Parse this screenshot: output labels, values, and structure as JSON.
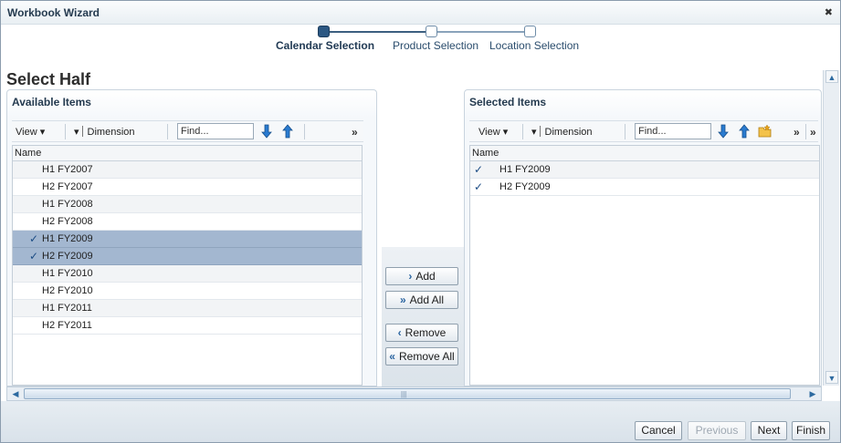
{
  "window": {
    "title": "Workbook Wizard",
    "close_glyph": "✖"
  },
  "train": {
    "steps": [
      {
        "label": "Calendar Selection",
        "active": true
      },
      {
        "label": "Product Selection",
        "active": false
      },
      {
        "label": "Location Selection",
        "active": false
      }
    ]
  },
  "page_title": "Select Half",
  "available": {
    "header": "Available Items",
    "toolbar": {
      "view_label": "View",
      "dimension_label": "Dimension",
      "find_placeholder": "Find...",
      "more_glyph": "»"
    },
    "column": "Name",
    "rows": [
      {
        "label": "H1 FY2007",
        "selected": false
      },
      {
        "label": "H2 FY2007",
        "selected": false
      },
      {
        "label": "H1 FY2008",
        "selected": false
      },
      {
        "label": "H2 FY2008",
        "selected": false
      },
      {
        "label": "H1 FY2009",
        "selected": true
      },
      {
        "label": "H2 FY2009",
        "selected": true
      },
      {
        "label": "H1 FY2010",
        "selected": false
      },
      {
        "label": "H2 FY2010",
        "selected": false
      },
      {
        "label": "H1 FY2011",
        "selected": false
      },
      {
        "label": "H2 FY2011",
        "selected": false
      }
    ]
  },
  "selected": {
    "header": "Selected Items",
    "toolbar": {
      "view_label": "View",
      "dimension_label": "Dimension",
      "find_placeholder": "Find...",
      "more_glyph": "»"
    },
    "column": "Name",
    "rows": [
      {
        "label": "H1 FY2009",
        "selected": true
      },
      {
        "label": "H2 FY2009",
        "selected": true
      }
    ]
  },
  "shuttle": {
    "add": {
      "icon": "›",
      "label": "Add"
    },
    "add_all": {
      "icon": "»",
      "label": "Add All"
    },
    "remove": {
      "icon": "‹",
      "label": "Remove"
    },
    "remove_all": {
      "icon": "«",
      "label": "Remove All"
    }
  },
  "footer": {
    "cancel": "Cancel",
    "previous": "Previous",
    "next": "Next",
    "finish": "Finish"
  },
  "colors": {
    "accent": "#2b5782",
    "selected_row": "#a3b7d0",
    "arrow_blue": "#2a7bd0"
  }
}
